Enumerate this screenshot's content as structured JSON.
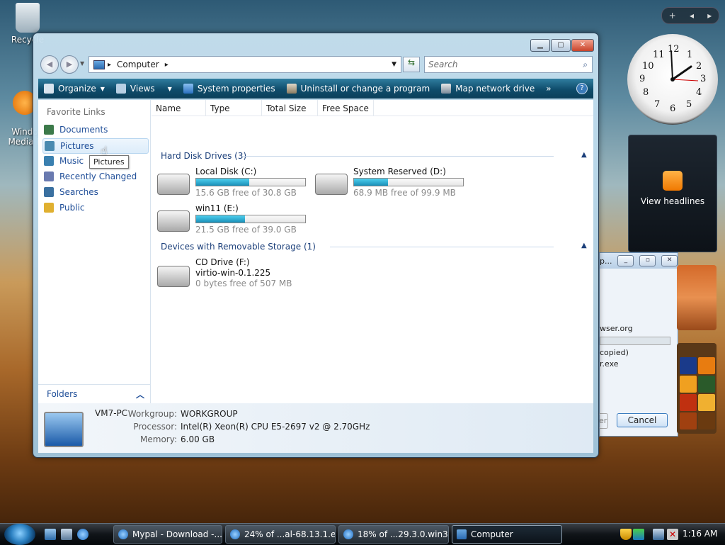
{
  "desktop": {
    "icons": [
      {
        "label": "Recycle",
        "icon": "recycle-bin-icon"
      },
      {
        "label": "Windo\nMedia P",
        "icon": "media-player-icon"
      }
    ]
  },
  "gadgets": {
    "controls": [
      "+",
      "◂",
      "▸"
    ],
    "clock_numbers": [
      "12",
      "1",
      "2",
      "3",
      "4",
      "5",
      "6",
      "7",
      "8",
      "9",
      "10",
      "11"
    ],
    "feed_label": "View headlines"
  },
  "bg_dialog": {
    "fragments": [
      "p...",
      "wser.org",
      "copied)",
      "r.exe",
      "er"
    ],
    "cancel_label": "Cancel"
  },
  "window": {
    "address": {
      "root_icon": "computer-icon",
      "path": "Computer",
      "chevron": "▸"
    },
    "search_placeholder": "Search",
    "commands": [
      {
        "label": "Organize",
        "icon": "organize-icon",
        "dropdown": true
      },
      {
        "label": "Views",
        "icon": "views-icon",
        "dropdown": true
      },
      {
        "label": "System properties",
        "icon": "system-properties-icon",
        "dropdown": false
      },
      {
        "label": "Uninstall or change a program",
        "icon": "uninstall-icon",
        "dropdown": false
      },
      {
        "label": "Map network drive",
        "icon": "network-drive-icon",
        "dropdown": false
      }
    ],
    "more": "»",
    "help": "?",
    "nav": {
      "heading": "Favorite Links",
      "links": [
        {
          "label": "Documents",
          "icon": "documents-icon",
          "color": "#3c7a4a"
        },
        {
          "label": "Pictures",
          "icon": "pictures-icon",
          "color": "#4a8ab0",
          "selected": true
        },
        {
          "label": "Music",
          "icon": "music-icon",
          "color": "#3a80b0"
        },
        {
          "label": "Recently Changed",
          "icon": "recent-icon",
          "color": "#6a7ab0"
        },
        {
          "label": "Searches",
          "icon": "searches-icon",
          "color": "#3a70a0"
        },
        {
          "label": "Public",
          "icon": "public-folder-icon",
          "color": "#e0b030"
        }
      ],
      "folders_label": "Folders",
      "folders_chevron": "︿"
    },
    "columns": [
      "Name",
      "Type",
      "Total Size",
      "Free Space"
    ],
    "groups": [
      {
        "title": "Hard Disk Drives (3)",
        "drives": [
          {
            "name": "Local Disk (C:)",
            "free": "15.6 GB free of 30.8 GB",
            "used_fraction": 0.49,
            "icon": "windows-drive-icon"
          },
          {
            "name": "System Reserved (D:)",
            "free": "68.9 MB free of 99.9 MB",
            "used_fraction": 0.31,
            "icon": "hard-drive-icon"
          },
          {
            "name": "win11 (E:)",
            "free": "21.5 GB free of 39.0 GB",
            "used_fraction": 0.45,
            "icon": "hard-drive-icon"
          }
        ]
      },
      {
        "title": "Devices with Removable Storage (1)",
        "drives": [
          {
            "name": "CD Drive (F:)",
            "label": "virtio-win-0.1.225",
            "free": "0 bytes free of 507 MB",
            "icon": "cd-drive-icon"
          }
        ]
      }
    ],
    "details": {
      "name": "VM7-PC",
      "rows": [
        {
          "label": "Workgroup:",
          "value": "WORKGROUP"
        },
        {
          "label": "Processor:",
          "value": "Intel(R) Xeon(R) CPU E5-2697 v2 @ 2.70GHz"
        },
        {
          "label": "Memory:",
          "value": "6.00 GB"
        }
      ]
    },
    "tooltip": "Pictures"
  },
  "taskbar": {
    "buttons": [
      {
        "label": "Mypal - Download -...",
        "icon": "ie-icon"
      },
      {
        "label": "24% of ...al-68.13.1.e...",
        "icon": "ie-icon"
      },
      {
        "label": "18% of ...29.3.0.win3...",
        "icon": "ie-icon"
      },
      {
        "label": "Computer",
        "icon": "computer-icon",
        "active": true
      }
    ],
    "time": "1:16 AM"
  }
}
